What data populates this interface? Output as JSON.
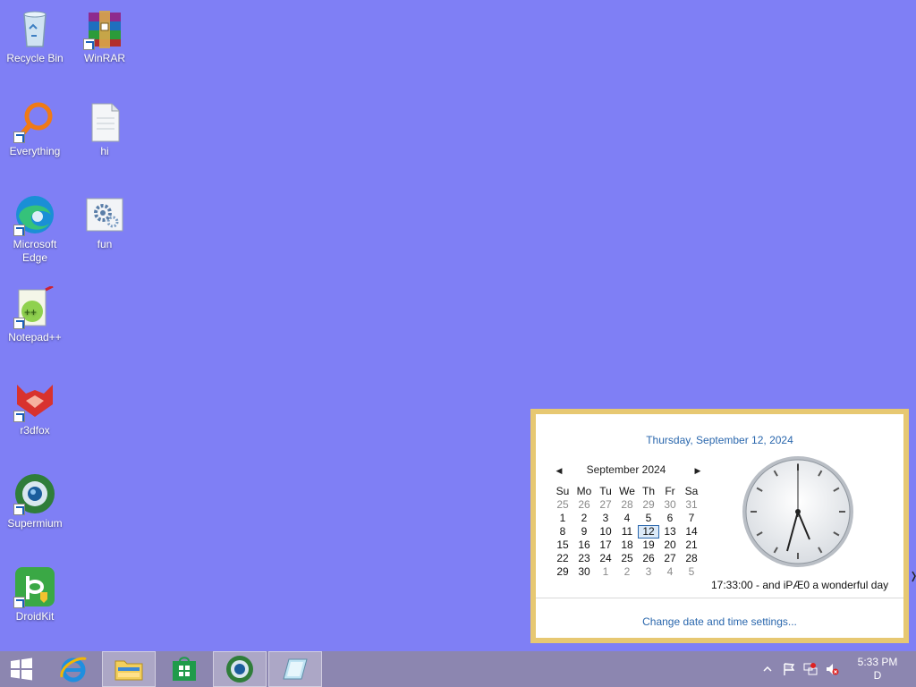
{
  "desktop": {
    "background": "#7f7ff5",
    "icons": [
      {
        "name": "recycle-bin",
        "label": "Recycle Bin",
        "icon": "recycle-bin-icon"
      },
      {
        "name": "winrar",
        "label": "WinRAR",
        "icon": "winrar-icon"
      },
      {
        "name": "everything",
        "label": "Everything",
        "icon": "everything-icon"
      },
      {
        "name": "hi-file",
        "label": "hi",
        "icon": "text-file-icon"
      },
      {
        "name": "microsoft-edge",
        "label": "Microsoft Edge",
        "icon": "edge-icon"
      },
      {
        "name": "fun",
        "label": "fun",
        "icon": "settings-file-icon"
      },
      {
        "name": "notepad-plus-plus",
        "label": "Notepad++",
        "icon": "notepad-plus-plus-icon"
      },
      {
        "name": "r3dfox",
        "label": "r3dfox",
        "icon": "r3dfox-icon"
      },
      {
        "name": "supermium",
        "label": "Supermium",
        "icon": "supermium-icon"
      },
      {
        "name": "droidkit",
        "label": "DroidKit",
        "icon": "droidkit-icon"
      }
    ]
  },
  "calendar": {
    "long_date": "Thursday, September 12, 2024",
    "month_label": "September 2024",
    "weekdays": [
      "Su",
      "Mo",
      "Tu",
      "We",
      "Th",
      "Fr",
      "Sa"
    ],
    "weeks": [
      [
        "25",
        "26",
        "27",
        "28",
        "29",
        "30",
        "31"
      ],
      [
        "1",
        "2",
        "3",
        "4",
        "5",
        "6",
        "7"
      ],
      [
        "8",
        "9",
        "10",
        "11",
        "12",
        "13",
        "14"
      ],
      [
        "15",
        "16",
        "17",
        "18",
        "19",
        "20",
        "21"
      ],
      [
        "22",
        "23",
        "24",
        "25",
        "26",
        "27",
        "28"
      ],
      [
        "29",
        "30",
        "1",
        "2",
        "3",
        "4",
        "5"
      ]
    ],
    "today": "12",
    "clock_text": "17:33:00 - and iPÆ0 a wonderful day",
    "change_link": "Change date and time settings...",
    "accent": "#2a67ad",
    "border_color": "#e7c872"
  },
  "taskbar": {
    "background": "#8c86b0",
    "buttons": [
      {
        "name": "start-button",
        "icon": "windows-logo-icon"
      },
      {
        "name": "internet-explorer-button",
        "icon": "internet-explorer-icon"
      },
      {
        "name": "file-explorer-button",
        "icon": "folder-icon"
      },
      {
        "name": "store-button",
        "icon": "store-icon"
      },
      {
        "name": "supermium-button",
        "icon": "supermium-icon"
      },
      {
        "name": "app-button",
        "icon": "app-icon"
      }
    ],
    "tray": {
      "time": "5:33 PM",
      "date": "D"
    }
  }
}
